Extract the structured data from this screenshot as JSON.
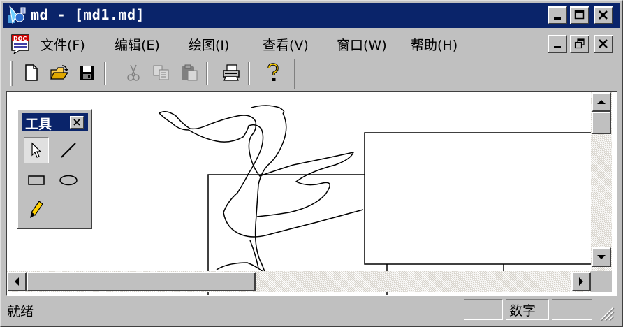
{
  "titlebar": {
    "title": "md - [md1.md]",
    "minimize_icon": "minimize-icon",
    "maximize_icon": "maximize-icon",
    "close_icon": "close-icon"
  },
  "menu": {
    "items": [
      {
        "label": "文件(F)"
      },
      {
        "label": "编辑(E)"
      },
      {
        "label": "绘图(I)"
      },
      {
        "label": "查看(V)"
      },
      {
        "label": "窗口(W)"
      },
      {
        "label": "帮助(H)"
      }
    ],
    "doc_icon": "document-icon"
  },
  "toolbar": {
    "buttons": [
      {
        "icon": "new-file-icon"
      },
      {
        "icon": "open-folder-icon"
      },
      {
        "icon": "save-icon"
      },
      {
        "icon": "cut-icon"
      },
      {
        "icon": "copy-icon"
      },
      {
        "icon": "paste-icon"
      },
      {
        "icon": "print-icon"
      },
      {
        "icon": "help-icon"
      }
    ]
  },
  "toolbox": {
    "title": "工具",
    "tools": [
      {
        "icon": "pointer-icon",
        "active": true
      },
      {
        "icon": "line-icon"
      },
      {
        "icon": "rectangle-icon"
      },
      {
        "icon": "ellipse-icon"
      },
      {
        "icon": "pencil-icon"
      }
    ]
  },
  "statusbar": {
    "text": "就绪",
    "indicator": "数字"
  },
  "colors": {
    "titlebar": "#0a246a",
    "face": "#c0c0c0"
  }
}
